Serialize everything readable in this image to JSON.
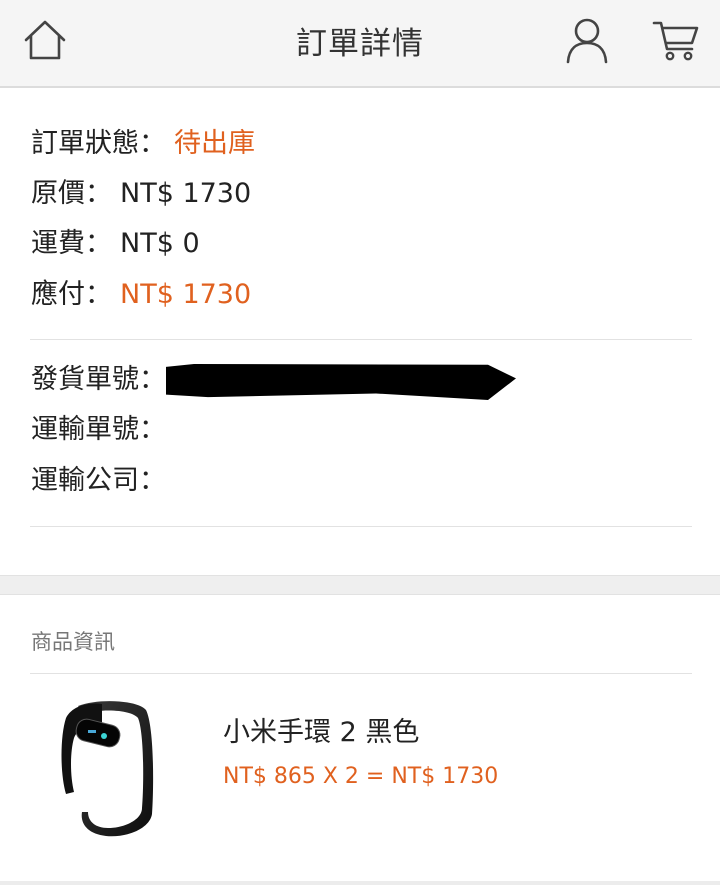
{
  "header": {
    "title": "訂單詳情",
    "icons": [
      "home-icon",
      "user-icon",
      "cart-icon"
    ]
  },
  "order": {
    "status_label": "訂單狀態：",
    "status_value": "待出庫",
    "original_price_label": "原價：",
    "original_price_value": "NT$ 1730",
    "shipping_label": "運費：",
    "shipping_value": "NT$ 0",
    "payable_label": "應付：",
    "payable_value": "NT$ 1730",
    "delivery_no_label": "發貨單號：",
    "transport_no_label": "運輸單號：",
    "transport_company_label": "運輸公司："
  },
  "product_info": {
    "section_label": "商品資訊",
    "items": [
      {
        "name": "小米手環 2 黑色",
        "price_line": "NT$ 865 X 2 = NT$ 1730"
      }
    ]
  },
  "colors": {
    "accent": "#e0611f",
    "header_bg": "#f5f5f5",
    "text": "#222222",
    "muted": "#777777"
  }
}
